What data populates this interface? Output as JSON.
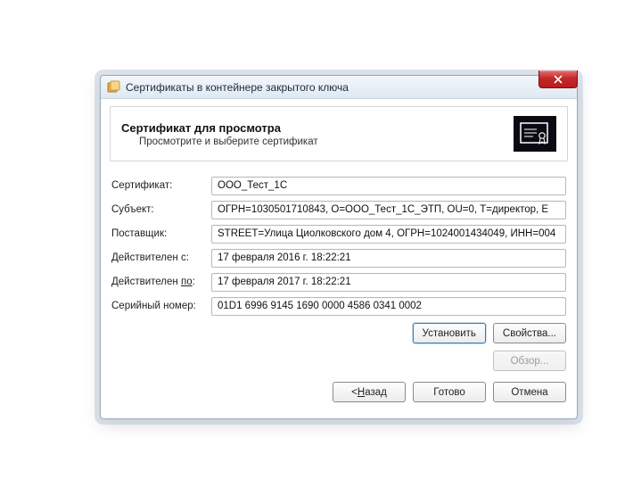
{
  "window": {
    "title": "Сертификаты в контейнере закрытого ключа"
  },
  "header": {
    "title": "Сертификат для просмотра",
    "subtitle": "Просмотрите и выберите сертификат"
  },
  "fields": {
    "certificate": {
      "label": "Сертификат:",
      "value": "ООО_Тест_1С"
    },
    "subject": {
      "label": "Субъект:",
      "value": "ОГРН=1030501710843, О=ООО_Тест_1С_ЭТП, OU=0, Т=директор, E"
    },
    "provider": {
      "label": "Поставщик:",
      "value": "STREET=Улица Циолковского дом 4, ОГРН=1024001434049, ИНН=004"
    },
    "valid_from": {
      "label": "Действителен с:",
      "value": "17 февраля 2016 г. 18:22:21"
    },
    "valid_to": {
      "label_prefix": "Действителен ",
      "label_underlined": "по",
      "label_suffix": ":",
      "value": "17 февраля 2017 г. 18:22:21"
    },
    "serial": {
      "label": "Серийный номер:",
      "value": "01D1 6996 9145 1690 0000 4586 0341 0002"
    }
  },
  "buttons": {
    "install": "Установить",
    "properties": "Свойства...",
    "browse": "Обзор...",
    "back_prefix": "< ",
    "back_underlined": "Н",
    "back_suffix": "азад",
    "finish": "Готово",
    "cancel": "Отмена"
  }
}
